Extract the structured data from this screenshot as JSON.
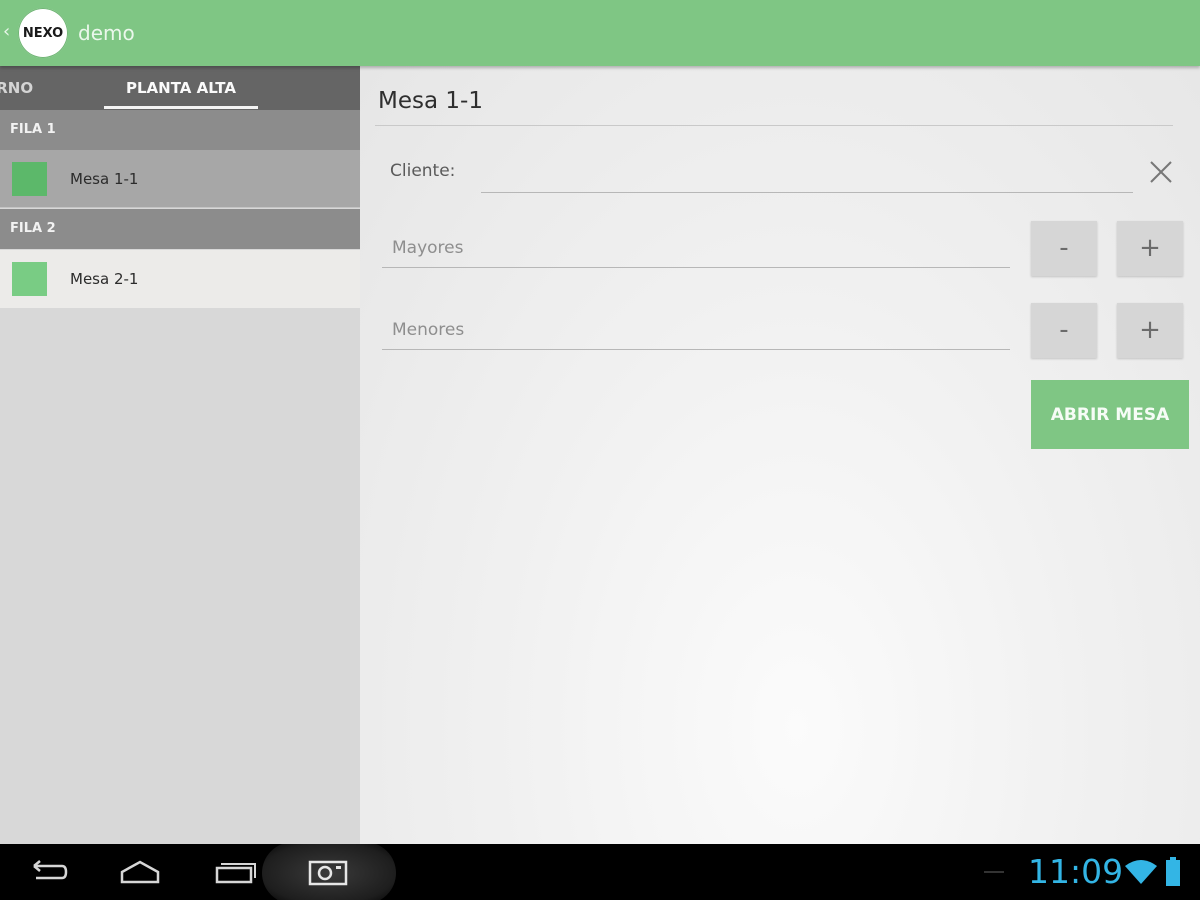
{
  "app": {
    "logo_text": "NEXO",
    "title": "demo",
    "colors": {
      "accent": "#7fc684",
      "tab_bar": "#656565",
      "section_header": "#8c8c8c",
      "clock": "#33b5e5"
    }
  },
  "tabs": [
    {
      "label": "ERNO",
      "selected": false
    },
    {
      "label": "PLANTA ALTA",
      "selected": true
    }
  ],
  "sections": [
    {
      "header": "FILA 1",
      "items": [
        {
          "label": "Mesa 1-1",
          "color": "#5cb86a",
          "selected": true
        }
      ]
    },
    {
      "header": "FILA 2",
      "items": [
        {
          "label": "Mesa 2-1",
          "color": "#79cc84",
          "selected": false
        }
      ]
    }
  ],
  "detail": {
    "title": "Mesa 1-1",
    "cliente_label": "Cliente:",
    "cliente_value": "",
    "mayores_placeholder": "Mayores",
    "menores_placeholder": "Menores",
    "minus_label": "-",
    "plus_label": "+",
    "open_button": "ABRIR MESA"
  },
  "system_bar": {
    "time": "11:09",
    "icons": [
      "back-icon",
      "home-icon",
      "recent-apps-icon",
      "screenshot-icon",
      "wifi-icon",
      "battery-icon"
    ]
  }
}
